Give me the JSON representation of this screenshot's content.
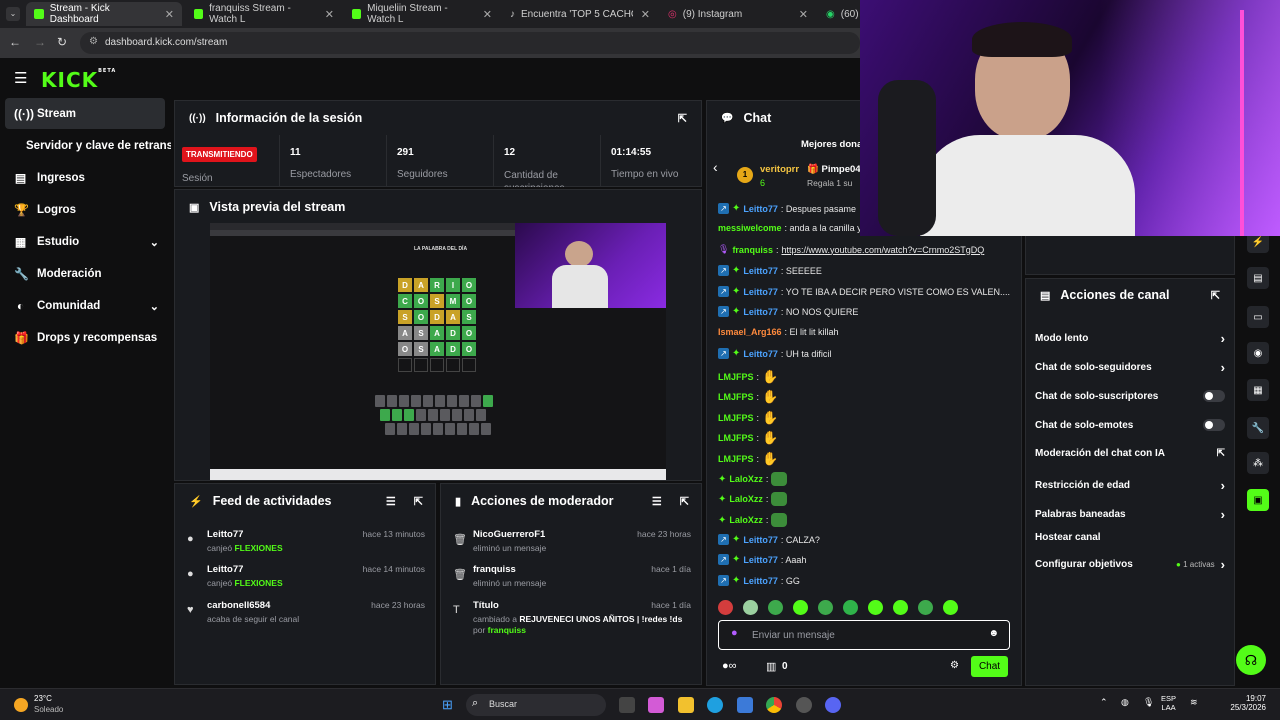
{
  "browser": {
    "tabs": [
      {
        "label": "Stream - Kick Dashboard"
      },
      {
        "label": "franquiss Stream - Watch L"
      },
      {
        "label": "Miqueliin Stream - Watch L"
      },
      {
        "label": "Encuentra 'TOP 5 CACHO Y HE"
      },
      {
        "label": "(9) Instagram"
      },
      {
        "label": "(60) W"
      }
    ],
    "url": "dashboard.kick.com/stream"
  },
  "kick": {
    "logo": "KICK",
    "beta": "BETA"
  },
  "sidebar": {
    "items": [
      {
        "label": "Stream"
      },
      {
        "label": "Servidor y clave de retransn"
      },
      {
        "label": "Ingresos"
      },
      {
        "label": "Logros"
      },
      {
        "label": "Estudio"
      },
      {
        "label": "Moderación"
      },
      {
        "label": "Comunidad"
      },
      {
        "label": "Drops y recompensas"
      }
    ]
  },
  "session": {
    "title": "Información de la sesión",
    "live_badge": "TRANSMITIENDO",
    "session_label": "Sesión",
    "stats": [
      {
        "value": "11",
        "label": "Espectadores"
      },
      {
        "value": "291",
        "label": "Seguidores"
      },
      {
        "value": "12",
        "label": "Cantidad de suscripciones"
      },
      {
        "value": "01:14:55",
        "label": "Tiempo en vivo"
      }
    ]
  },
  "preview": {
    "title": "Vista previa del stream",
    "game_title": "LA PALABRA DEL DÍA",
    "rows": [
      "DARIO",
      "COSMO",
      "SODAS",
      "ASADO",
      "OSADO"
    ]
  },
  "feed": {
    "title": "Feed de actividades",
    "items": [
      {
        "name": "Leitto77",
        "time": "hace 13 minutos",
        "desc": "canjeó",
        "reward": "FLEXIONES"
      },
      {
        "name": "Leitto77",
        "time": "hace 14 minutos",
        "desc": "canjeó",
        "reward": "FLEXIONES"
      },
      {
        "name": "carbonell6584",
        "time": "hace 23 horas",
        "desc": "acaba de seguir el canal",
        "reward": ""
      }
    ]
  },
  "modactions": {
    "title": "Acciones de moderador",
    "items": [
      {
        "name": "NicoGuerreroF1",
        "time": "hace 23 horas",
        "desc": "eliminó un mensaje"
      },
      {
        "name": "franquiss",
        "time": "hace 1 día",
        "desc": "eliminó un mensaje"
      },
      {
        "name": "Título",
        "time": "hace 1 día",
        "desc": "cambiado a",
        "bold": "REJUVENECI UNOS AÑITOS | !redes !ds",
        "by": "por",
        "byuser": "franquiss"
      }
    ]
  },
  "chat": {
    "title": "Chat",
    "top_donors_label": "Mejores dona",
    "donor1": {
      "name": "veritoprr",
      "amount": "6",
      "rank": "1"
    },
    "donor2": {
      "name": "Pimpe04",
      "note": "Regala 1 su"
    },
    "messages": [
      {
        "user": "Leitto77",
        "text": ": Despues pasame"
      },
      {
        "user": "messiwelcome",
        "text": ": anda a la canilla y"
      },
      {
        "user": "franquiss",
        "text": ":",
        "link": "https://www.youtube.com/watch?v=Crnmo2STgDQ"
      },
      {
        "user": "Leitto77",
        "text": ": SEEEEE"
      },
      {
        "user": "Leitto77",
        "text": ": YO TE IBA A DECIR PERO VISTE COMO ES VALEN...."
      },
      {
        "user": "Leitto77",
        "text": ": NO NOS QUIERE"
      },
      {
        "user": "Ismael_Arg166",
        "text": ": El lit lit killah"
      },
      {
        "user": "Leitto77",
        "text": ": UH ta dificil"
      },
      {
        "user": "LMJFPS",
        "text": ":"
      },
      {
        "user": "LMJFPS",
        "text": ":"
      },
      {
        "user": "LMJFPS",
        "text": ":"
      },
      {
        "user": "LMJFPS",
        "text": ":"
      },
      {
        "user": "LMJFPS",
        "text": ":"
      },
      {
        "user": "LaloXzz",
        "text": ":"
      },
      {
        "user": "LaloXzz",
        "text": ":"
      },
      {
        "user": "LaloXzz",
        "text": ":"
      },
      {
        "user": "Leitto77",
        "text": ": CALZA?"
      },
      {
        "user": "Leitto77",
        "text": ": Aaah"
      },
      {
        "user": "Leitto77",
        "text": ": GG"
      }
    ],
    "input_placeholder": "Enviar un mensaje",
    "viewers_count": "0",
    "send_label": "Chat"
  },
  "channel_actions": {
    "title": "Acciones de canal",
    "items": [
      {
        "label": "Modo lento"
      },
      {
        "label": "Chat de solo-seguidores"
      },
      {
        "label": "Chat de solo-suscriptores"
      },
      {
        "label": "Chat de solo-emotes"
      },
      {
        "label": "Moderación del chat con IA"
      },
      {
        "label": "Restricción de edad"
      },
      {
        "label": "Palabras baneadas"
      },
      {
        "label": "Hostear canal"
      },
      {
        "label": "Configurar objetivos"
      }
    ],
    "goals_active": "1 activas"
  },
  "taskbar": {
    "weather_temp": "23°C",
    "weather_desc": "Soleado",
    "search": "Buscar",
    "lang1": "ESP",
    "lang2": "LAA",
    "time": "19:07",
    "date": "25/3/2026"
  }
}
